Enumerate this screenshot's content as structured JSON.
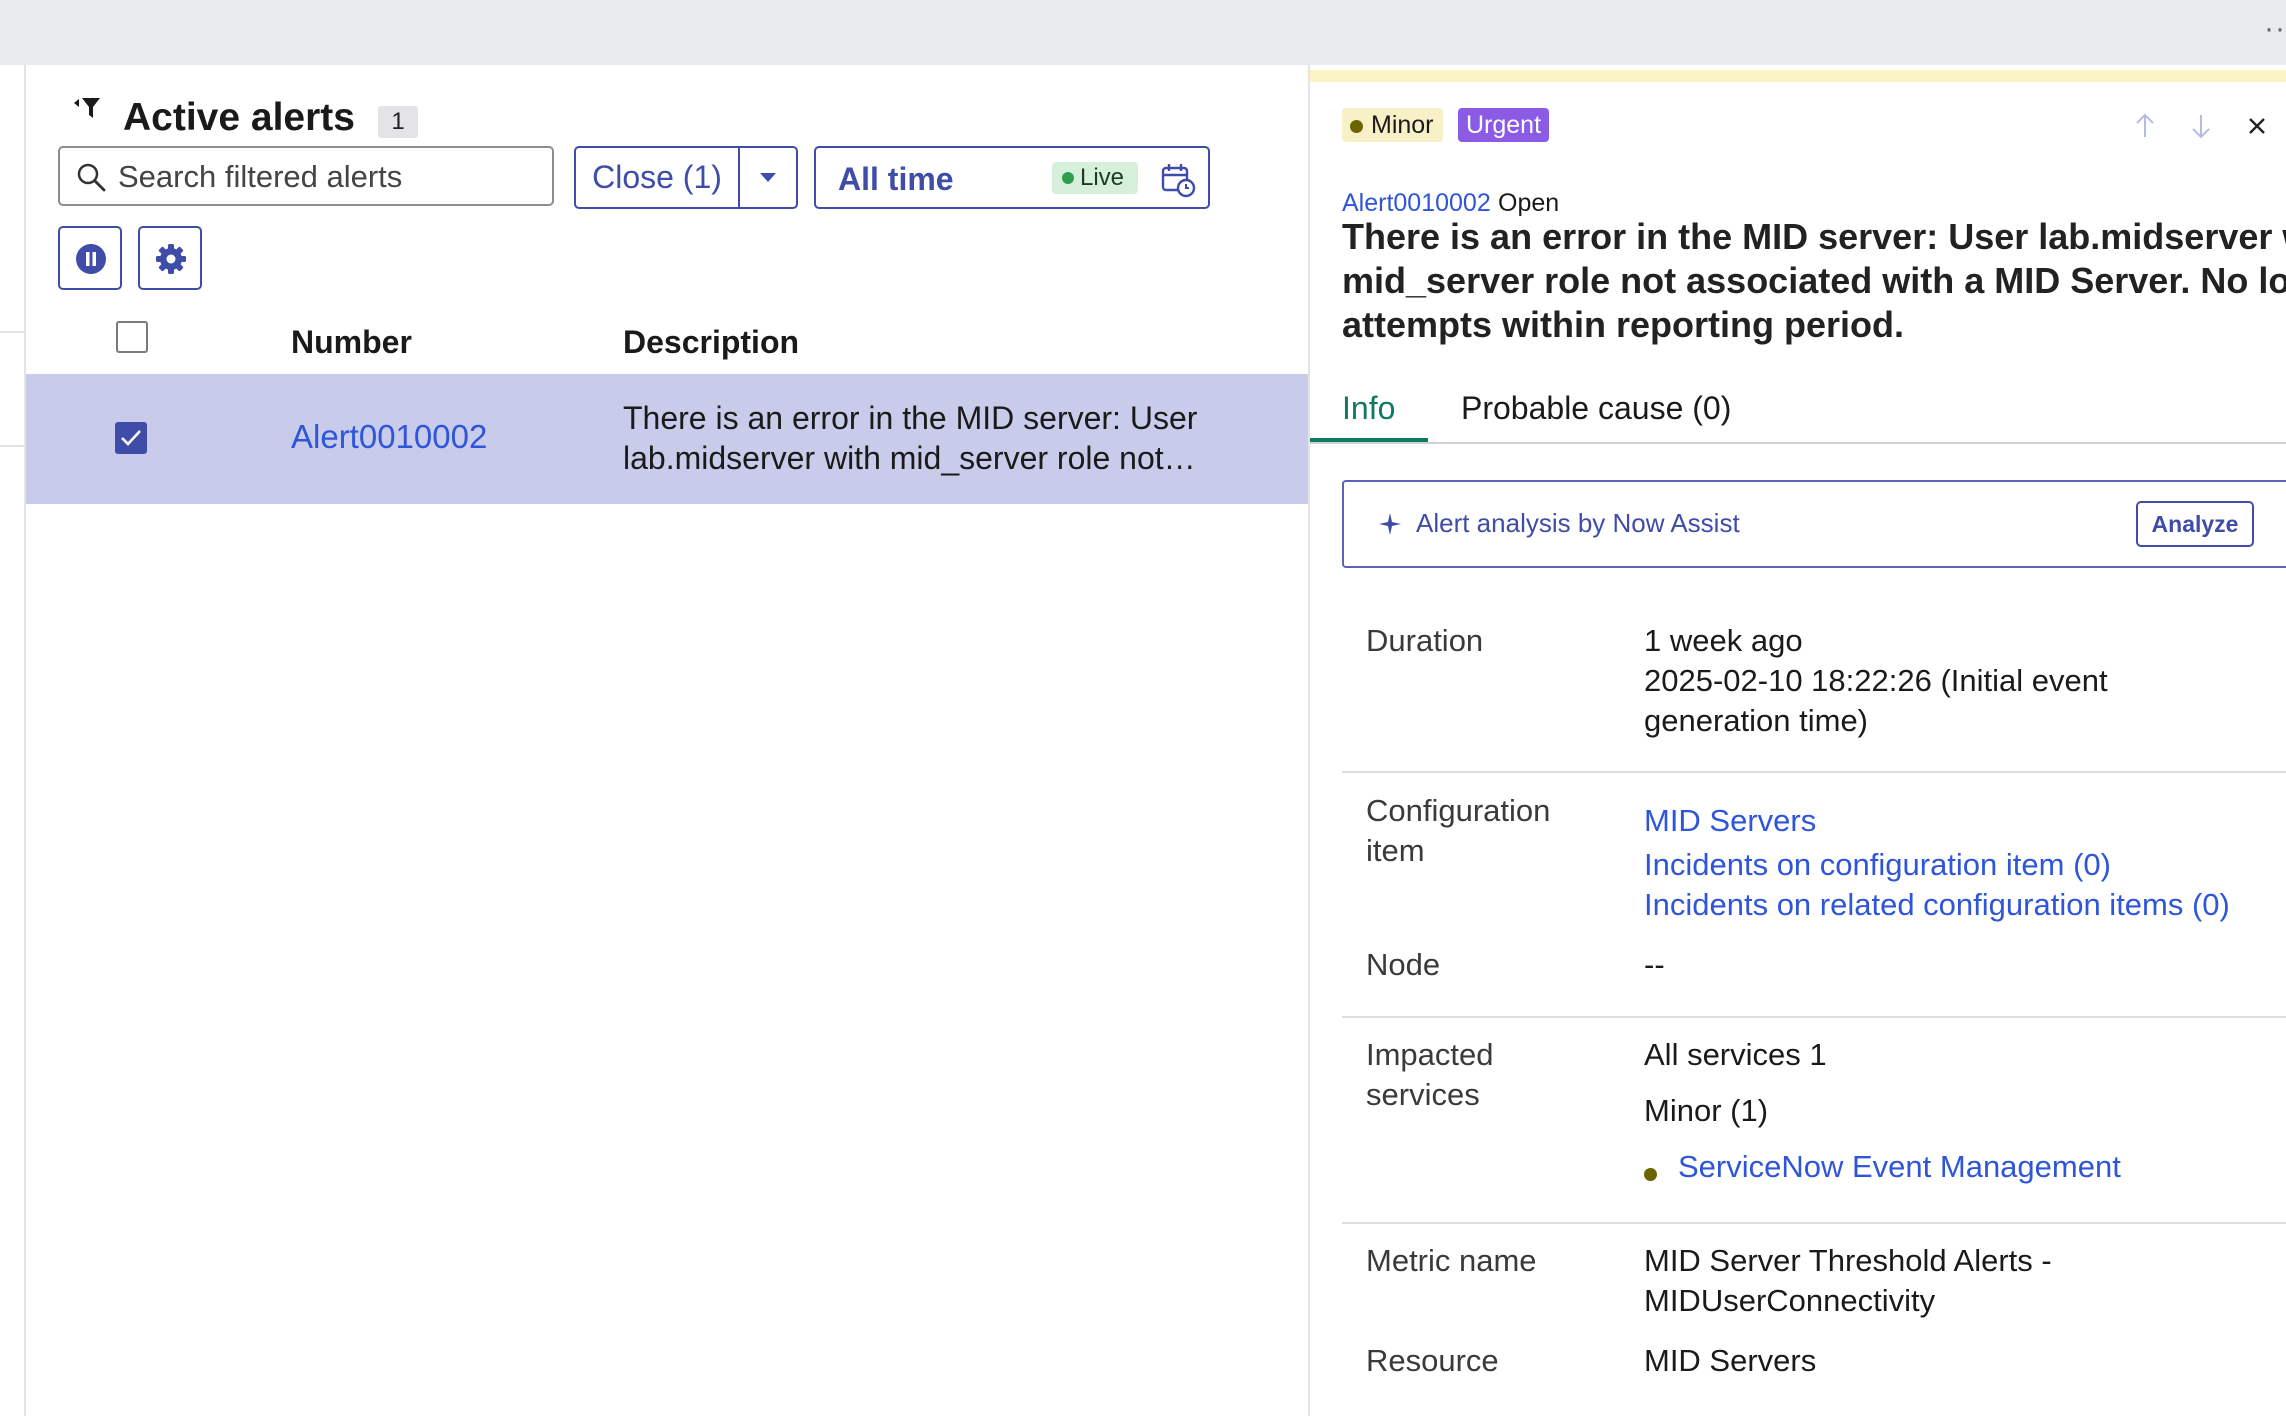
{
  "list": {
    "title": "Active alerts",
    "count": "1",
    "search_placeholder": "Search filtered alerts",
    "close_label": "Close (1)",
    "time_label": "All time",
    "live_label": "Live",
    "columns": {
      "number": "Number",
      "description": "Description"
    },
    "rows": [
      {
        "number": "Alert0010002",
        "description_line1": "There is an error in the MID server: User",
        "description_line2": "lab.midserver with mid_server role not…",
        "selected": true
      }
    ]
  },
  "detail": {
    "severity": "Minor",
    "urgency": "Urgent",
    "alert_id": "Alert0010002",
    "state": "Open",
    "title_lines": [
      "There is an error in the MID server: User lab.midserver with",
      "mid_server role not associated with a MID Server. No login",
      "attempts within reporting period."
    ],
    "tabs": {
      "info": "Info",
      "probable_cause": "Probable cause (0)"
    },
    "assist": {
      "label": "Alert analysis by Now Assist",
      "button": "Analyze"
    },
    "fields": {
      "duration_label": "Duration",
      "duration_value": "1 week ago",
      "duration_detail_1": "2025-02-10 18:22:26 (Initial event",
      "duration_detail_2": "generation time)",
      "ci_label_1": "Configuration",
      "ci_label_2": "item",
      "ci_value": "MID Servers",
      "ci_incidents": "Incidents on configuration item (0)",
      "ci_related_incidents": "Incidents on related configuration items (0)",
      "node_label": "Node",
      "node_value": "--",
      "impacted_label_1": "Impacted",
      "impacted_label_2": "services",
      "all_services": "All services 1",
      "minor_count": "Minor (1)",
      "service_link": "ServiceNow Event Management",
      "metric_label": "Metric name",
      "metric_value_1": "MID Server Threshold Alerts -",
      "metric_value_2": "MIDUserConnectivity",
      "resource_label": "Resource",
      "resource_value": "MID Servers"
    }
  },
  "colors": {
    "accent": "#3f4ca8",
    "link": "#2f55d9",
    "selected_row": "#c9cbeb",
    "urgent": "#8b5be5",
    "minor_badge": "#f8f0c6",
    "info_tab": "#0f7a63",
    "live": "#d7f0dc"
  }
}
